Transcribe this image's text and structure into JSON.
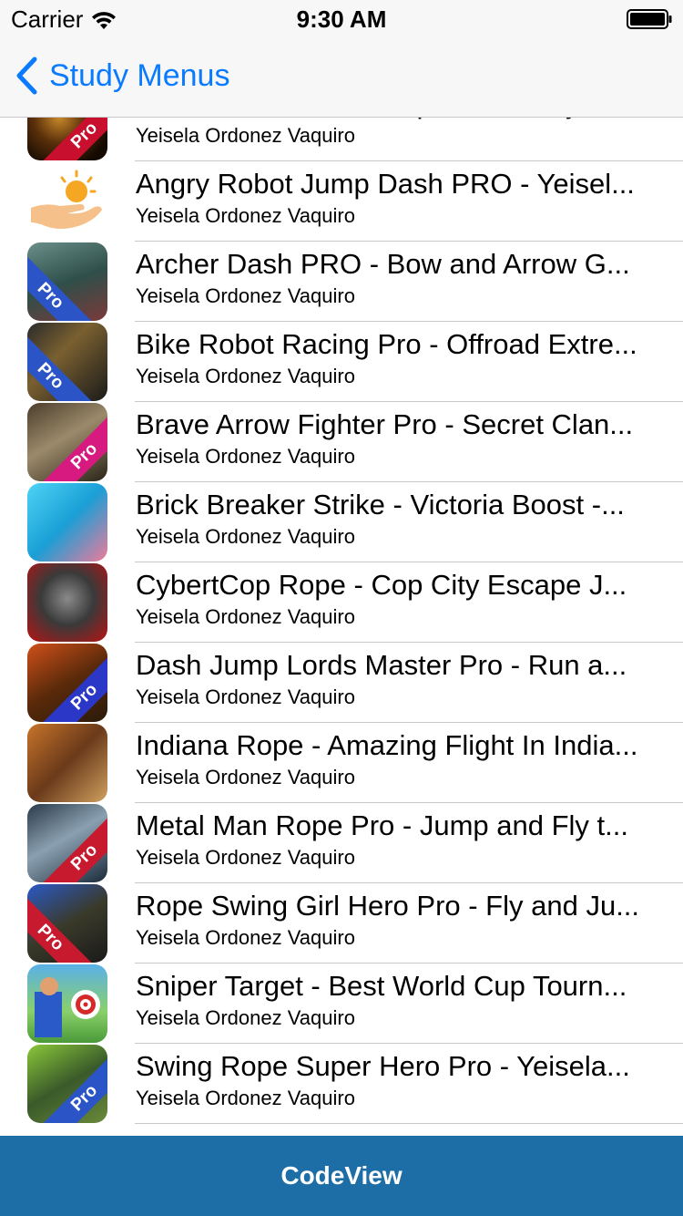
{
  "status_bar": {
    "carrier": "Carrier",
    "time": "9:30 AM",
    "wifi_icon": "wifi-icon",
    "battery_icon": "battery-icon"
  },
  "nav_bar": {
    "back_label": "Study Menus",
    "back_icon": "chevron-left-icon",
    "accent_color": "#0a7aff"
  },
  "list": {
    "items": [
      {
        "title": "A Monster Shadow Rope Pro - Ninja...",
        "subtitle": "Yeisela Ordonez Vaquiro",
        "icon": "monster-shadow-app-icon",
        "badge": "Pro"
      },
      {
        "title": "Angry Robot Jump Dash PRO - Yeisel...",
        "subtitle": "Yeisela Ordonez Vaquiro",
        "icon": "sun-hand-placeholder-icon",
        "badge": ""
      },
      {
        "title": "Archer Dash PRO - Bow and Arrow G...",
        "subtitle": "Yeisela Ordonez Vaquiro",
        "icon": "archer-app-icon",
        "badge": "Pro"
      },
      {
        "title": "Bike Robot Racing Pro - Offroad Extre...",
        "subtitle": "Yeisela Ordonez Vaquiro",
        "icon": "bike-robot-app-icon",
        "badge": "Pro"
      },
      {
        "title": "Brave Arrow Fighter Pro - Secret Clan...",
        "subtitle": "Yeisela Ordonez Vaquiro",
        "icon": "brave-arrow-app-icon",
        "badge": "Pro"
      },
      {
        "title": "Brick Breaker Strike - Victoria Boost -...",
        "subtitle": "Yeisela Ordonez Vaquiro",
        "icon": "brick-breaker-app-icon",
        "badge": ""
      },
      {
        "title": "CybertCop Rope - Cop City Escape J...",
        "subtitle": "Yeisela Ordonez Vaquiro",
        "icon": "cybertcop-app-icon",
        "badge": ""
      },
      {
        "title": "Dash Jump Lords Master Pro - Run a...",
        "subtitle": "Yeisela Ordonez Vaquiro",
        "icon": "dash-jump-app-icon",
        "badge": "Pro"
      },
      {
        "title": "Indiana Rope - Amazing Flight In India...",
        "subtitle": "Yeisela Ordonez Vaquiro",
        "icon": "indiana-rope-app-icon",
        "badge": ""
      },
      {
        "title": "Metal Man Rope Pro - Jump and Fly t...",
        "subtitle": "Yeisela Ordonez Vaquiro",
        "icon": "metal-man-app-icon",
        "badge": "Pro"
      },
      {
        "title": "Rope Swing Girl Hero Pro - Fly and Ju...",
        "subtitle": "Yeisela Ordonez Vaquiro",
        "icon": "rope-swing-girl-app-icon",
        "badge": "Pro"
      },
      {
        "title": "Sniper Target - Best World Cup Tourn...",
        "subtitle": "Yeisela Ordonez Vaquiro",
        "icon": "sniper-target-app-icon",
        "badge": ""
      },
      {
        "title": "Swing Rope Super Hero Pro - Yeisela...",
        "subtitle": "Yeisela Ordonez Vaquiro",
        "icon": "swing-rope-hero-app-icon",
        "badge": "Pro"
      }
    ]
  },
  "bottom_bar": {
    "label": "CodeView",
    "color": "#1d6ea6"
  }
}
